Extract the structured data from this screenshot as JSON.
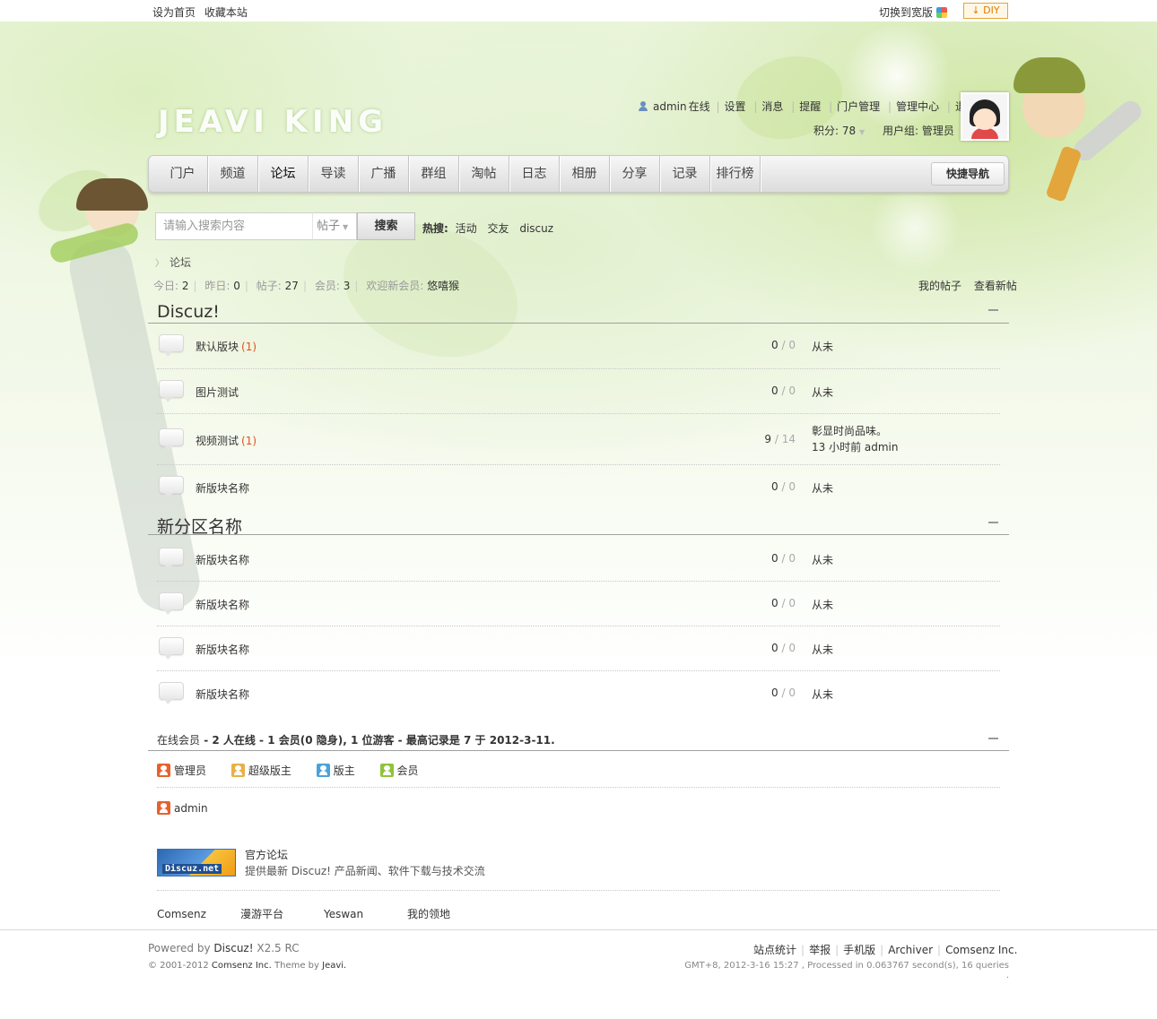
{
  "topbar": {
    "set_home": "设为首页",
    "bookmark": "收藏本站",
    "switch_wide": "切换到宽版",
    "diy": "DIY"
  },
  "header": {
    "logo_text": "JEAVI KING",
    "username": "admin",
    "status": "在线",
    "links": [
      "设置",
      "消息",
      "提醒",
      "门户管理",
      "管理中心",
      "退出"
    ],
    "credits": "积分: 78",
    "usergroup": "用户组: 管理员"
  },
  "nav": {
    "items": [
      "门户",
      "频道",
      "论坛",
      "导读",
      "广播",
      "群组",
      "淘帖",
      "日志",
      "相册",
      "分享",
      "记录",
      "排行榜"
    ],
    "active_index": 2,
    "quick_nav": "快捷导航"
  },
  "search": {
    "placeholder": "请输入搜索内容",
    "type": "帖子",
    "button": "搜索",
    "hot_label": "热搜:",
    "hot_terms": [
      "活动",
      "交友",
      "discuz"
    ]
  },
  "breadcrumb": "论坛",
  "stats": {
    "today_label": "今日:",
    "today": "2",
    "yesterday_label": "昨日:",
    "yesterday": "0",
    "posts_label": "帖子:",
    "posts": "27",
    "members_label": "会员:",
    "members": "3",
    "welcome_label": "欢迎新会员:",
    "newest_member": "悠嘻猴",
    "my_posts": "我的帖子",
    "new_posts": "查看新帖"
  },
  "categories": [
    {
      "title": "Discuz!",
      "forums": [
        {
          "name": "默认版块",
          "today": "(1)",
          "threads": "0",
          "posts": "0",
          "last": "从未",
          "last2": ""
        },
        {
          "name": "图片测试",
          "today": "",
          "threads": "0",
          "posts": "0",
          "last": "从未",
          "last2": ""
        },
        {
          "name": "视频测试",
          "today": "(1)",
          "threads": "9",
          "posts": "14",
          "last": "彰显时尚品味。",
          "last2": "13 小时前 admin"
        },
        {
          "name": "新版块名称",
          "today": "",
          "threads": "0",
          "posts": "0",
          "last": "从未",
          "last2": ""
        }
      ]
    },
    {
      "title": "新分区名称",
      "forums": [
        {
          "name": "新版块名称",
          "today": "",
          "threads": "0",
          "posts": "0",
          "last": "从未",
          "last2": ""
        },
        {
          "name": "新版块名称",
          "today": "",
          "threads": "0",
          "posts": "0",
          "last": "从未",
          "last2": ""
        },
        {
          "name": "新版块名称",
          "today": "",
          "threads": "0",
          "posts": "0",
          "last": "从未",
          "last2": ""
        },
        {
          "name": "新版块名称",
          "today": "",
          "threads": "0",
          "posts": "0",
          "last": "从未",
          "last2": ""
        }
      ]
    }
  ],
  "online": {
    "label": "在线会员",
    "summary": " - 2 人在线 - 1 会员(0 隐身), 1 位游客 - 最高记录是 7 于 2012-3-11.",
    "legend": [
      "管理员",
      "超级版主",
      "版主",
      "会员"
    ],
    "users": [
      "admin"
    ]
  },
  "links": {
    "partner_logo_text": "Discuz.net",
    "partner_name": "官方论坛",
    "partner_desc": "提供最新 Discuz! 产品新闻、软件下载与技术交流",
    "text_links": [
      "Comsenz",
      "漫游平台",
      "Yeswan",
      "我的领地"
    ]
  },
  "footer": {
    "powered_by": "Powered by",
    "product": "Discuz!",
    "version": "X2.5 RC",
    "copyright": "© 2001-2012",
    "company": "Comsenz Inc.",
    "theme_by": "Theme by",
    "theme_author": "Jeavi.",
    "links": [
      "站点统计",
      "举报",
      "手机版",
      "Archiver",
      "Comsenz Inc."
    ],
    "debug": "GMT+8, 2012-3-16 15:27 , Processed in 0.063767 second(s), 16 queries ."
  },
  "colors": {
    "accent": "#e0531a",
    "nav_bg": "#e8e8e8",
    "scene_green": "#dcefc0"
  }
}
